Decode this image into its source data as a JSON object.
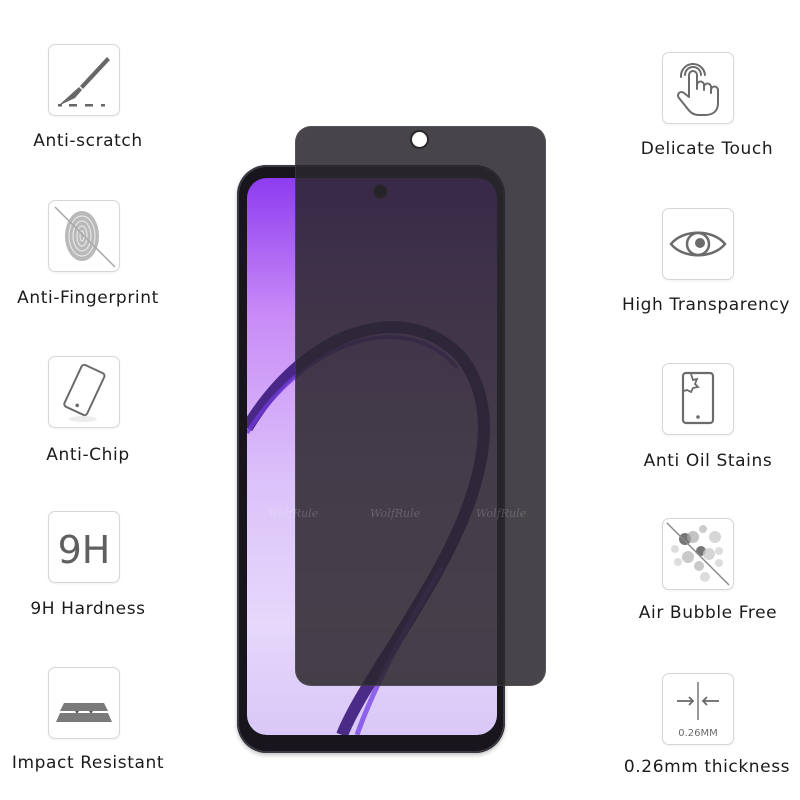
{
  "features_left": [
    {
      "label": "Anti-scratch",
      "icon": "scalpel-scratch-icon"
    },
    {
      "label": "Anti-Fingerprint",
      "icon": "fingerprint-crossed-icon"
    },
    {
      "label": "Anti-Chip",
      "icon": "tilted-phone-icon"
    },
    {
      "label": "9H Hardness",
      "icon": "9h-icon",
      "icon_text": "9H"
    },
    {
      "label": "Impact Resistant",
      "icon": "layers-impact-icon"
    }
  ],
  "features_right": [
    {
      "label": "Delicate Touch",
      "icon": "touch-hand-icon"
    },
    {
      "label": "High Transparency",
      "icon": "eye-icon"
    },
    {
      "label": "Anti Oil Stains",
      "icon": "phone-stain-icon"
    },
    {
      "label": "Air Bubble Free",
      "icon": "bubbles-crossed-icon"
    },
    {
      "label": "0.26mm thickness",
      "icon": "thickness-arrows-icon",
      "icon_text": "0.26MM"
    }
  ],
  "watermark": "WolfRule",
  "colors": {
    "film": "#2a262c",
    "screen_top": "#8e3cf0",
    "screen_bottom": "#e6d7fb",
    "icon_gray": "#6b6b6b"
  }
}
